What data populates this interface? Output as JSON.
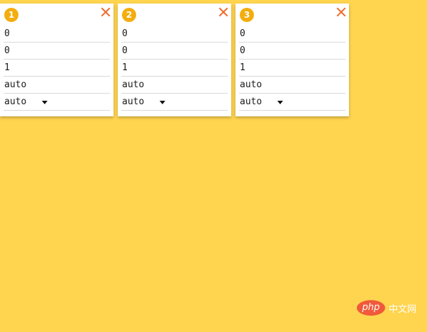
{
  "cards": [
    {
      "badge": "1",
      "close_symbol": "×",
      "fields": [
        "0",
        "0",
        "1",
        "auto"
      ],
      "select_value": "auto"
    },
    {
      "badge": "2",
      "close_symbol": "×",
      "fields": [
        "0",
        "0",
        "1",
        "auto"
      ],
      "select_value": "auto"
    },
    {
      "badge": "3",
      "close_symbol": "×",
      "fields": [
        "0",
        "0",
        "1",
        "auto"
      ],
      "select_value": "auto"
    }
  ],
  "watermark": {
    "logo_text": "php",
    "site_text": "中文网"
  },
  "colors": {
    "background": "#ffd44f",
    "badge": "#f3ad0f",
    "close": "#f06a2b",
    "card": "#ffffff"
  },
  "icons": {
    "close": "close-icon",
    "dropdown": "chevron-down-icon"
  }
}
